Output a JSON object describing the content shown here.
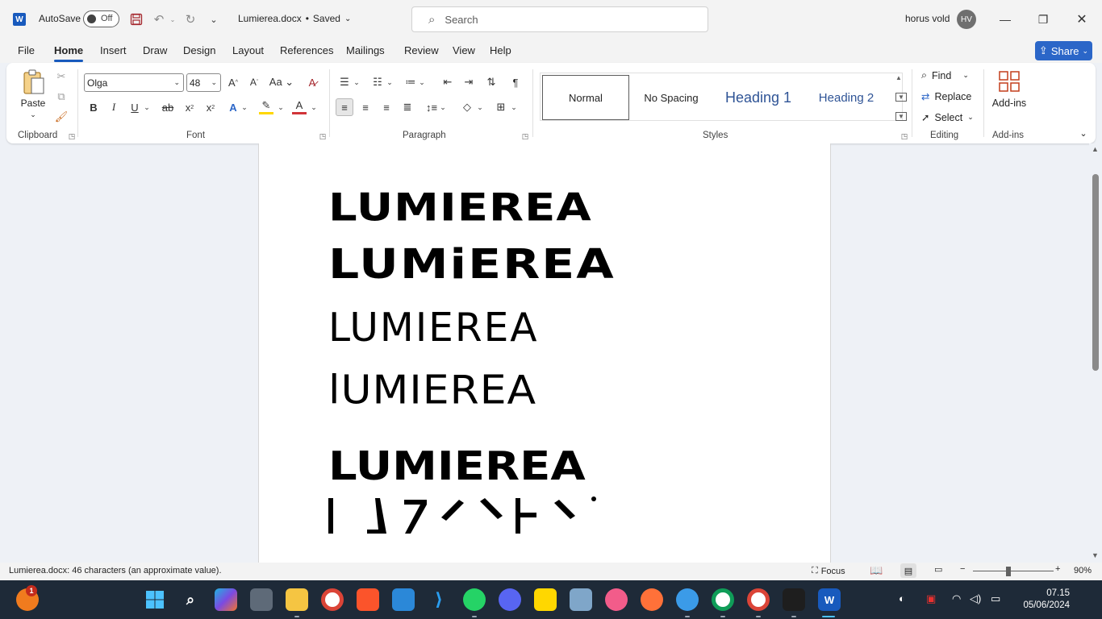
{
  "titlebar": {
    "app_logo": "W",
    "autosave_label": "AutoSave",
    "autosave_state": "Off",
    "doc_title": "Lumierea.docx",
    "doc_status": "Saved",
    "search_placeholder": "Search",
    "user_name": "horus vold",
    "user_initials": "HV"
  },
  "tabs": [
    "File",
    "Home",
    "Insert",
    "Draw",
    "Design",
    "Layout",
    "References",
    "Mailings",
    "Review",
    "View",
    "Help"
  ],
  "active_tab": "Home",
  "share_label": "Share",
  "ribbon": {
    "clipboard": {
      "paste": "Paste",
      "group": "Clipboard"
    },
    "font": {
      "name": "Olga",
      "size": "48",
      "group": "Font"
    },
    "paragraph": {
      "group": "Paragraph"
    },
    "styles": {
      "items": [
        "Normal",
        "No Spacing",
        "Heading 1",
        "Heading 2"
      ],
      "group": "Styles"
    },
    "editing": {
      "find": "Find",
      "replace": "Replace",
      "select": "Select",
      "group": "Editing"
    },
    "addins": {
      "label": "Add-ins",
      "group": "Add-ins"
    }
  },
  "document": {
    "lines": [
      "LUMIEREA",
      "LUMiEREA",
      "LUMIERЕA",
      "lUMIEREA",
      "LUMIEREA"
    ]
  },
  "statusbar": {
    "word_count": "Lumierea.docx: 46 characters (an approximate value).",
    "focus": "Focus",
    "zoom": "90%"
  },
  "taskbar": {
    "time": "07.15",
    "date": "05/06/2024",
    "notification_badge": "1"
  },
  "colors": {
    "word_blue": "#185abd",
    "share_blue": "#2b66c8",
    "taskbar": "#1e2a38"
  }
}
